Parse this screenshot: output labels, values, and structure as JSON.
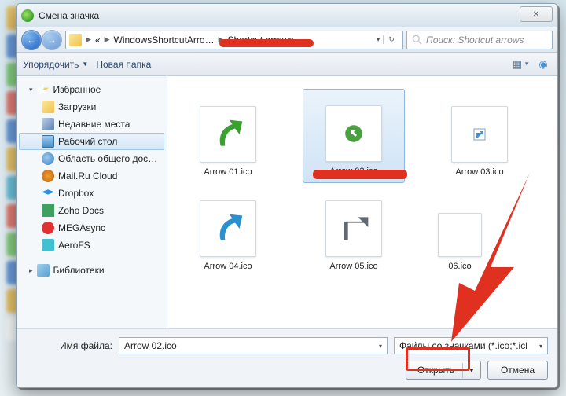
{
  "window": {
    "title": "Смена значка",
    "close_symbol": "✕"
  },
  "nav": {
    "back": "←",
    "forward": "→"
  },
  "breadcrumb": {
    "ellipsis": "«",
    "part1": "WindowsShortcutArro…",
    "part2": "Shortcut arrows"
  },
  "search": {
    "placeholder": "Поиск: Shortcut arrows"
  },
  "toolbar": {
    "organize": "Упорядочить",
    "new_folder": "Новая папка"
  },
  "sidebar": {
    "favorites": {
      "label": "Избранное",
      "items": [
        {
          "label": "Загрузки"
        },
        {
          "label": "Недавние места"
        },
        {
          "label": "Рабочий стол"
        },
        {
          "label": "Область общего доступа"
        },
        {
          "label": "Mail.Ru Cloud"
        },
        {
          "label": "Dropbox"
        },
        {
          "label": "Zoho Docs"
        },
        {
          "label": "MEGAsync"
        },
        {
          "label": "AeroFS"
        }
      ]
    },
    "libraries": {
      "label": "Библиотеки"
    }
  },
  "files": [
    {
      "name": "Arrow 01.ico"
    },
    {
      "name": "Arrow 02.ico"
    },
    {
      "name": "Arrow 03.ico"
    },
    {
      "name": "Arrow 04.ico"
    },
    {
      "name": "Arrow 05.ico"
    },
    {
      "name": "06.ico"
    }
  ],
  "bottom": {
    "filename_label": "Имя файла:",
    "filename_value": "Arrow 02.ico",
    "filter_label": "Файлы со значками (*.ico;*.icl",
    "open": "Открыть",
    "cancel": "Отмена"
  }
}
